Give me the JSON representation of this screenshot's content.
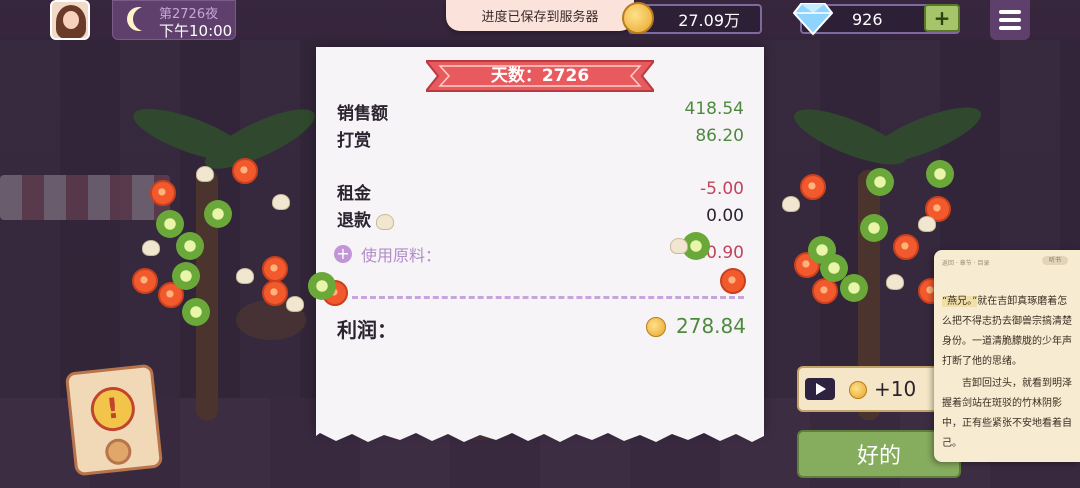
{
  "hud": {
    "day_night": "第2726夜",
    "time": "下午10:00",
    "money": "27.09万",
    "gems": "926",
    "plus_label": "+"
  },
  "toast": "进度已保存到服务器",
  "receipt": {
    "title": "天数：2726",
    "sales_label": "销售额",
    "sales_value": "418.54",
    "tips_label": "打赏",
    "tips_value": "86.20",
    "rent_label": "租金",
    "rent_value": "-5.00",
    "refund_label": "退款",
    "refund_value": "0.00",
    "ingredients_label": "使用原料：",
    "ingredients_value": "-20.90",
    "profit_label": "利润：",
    "profit_value": "278.84"
  },
  "actions": {
    "ad_reward": "+10",
    "ok_label": "好的"
  },
  "alert_mark": "!",
  "reader": {
    "top_bar": "返回 · 章节 · 目录",
    "pill": "听书",
    "para1_highlight": "“燕兄。”",
    "para1_rest": "就在吉卸真琢磨着怎么把不得志扔去御兽宗搞清楚身份。一道清脆朦胧的少年声打断了他的思绪。",
    "para2": "吉卸回过头，就看到明泽握着剑站在斑驳的竹林阴影中，正有些紧张不安地看着自己。"
  },
  "colors": {
    "positive": "#4d8a3d",
    "negative": "#c0445a",
    "ribbon": "#e85a5e",
    "ok_button": "#86ac5e"
  }
}
